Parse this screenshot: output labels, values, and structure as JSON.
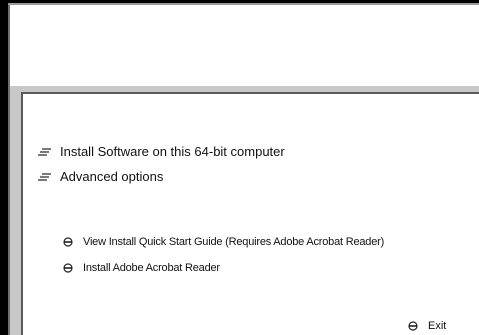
{
  "menu": {
    "main_items": [
      {
        "label": "Install Software on this 64-bit computer",
        "icon": "lines-icon"
      },
      {
        "label": "Advanced options",
        "icon": "lines-icon"
      }
    ],
    "sub_items": [
      {
        "label": "View Install Quick Start Guide (Requires Adobe Acrobat Reader)",
        "icon": "bullet-icon"
      },
      {
        "label": "Install Adobe Acrobat Reader",
        "icon": "bullet-icon"
      }
    ],
    "exit": {
      "label": "Exit",
      "icon": "bullet-icon"
    }
  },
  "colors": {
    "frame": "#000000",
    "strip": "#c8c8c8",
    "panel": "#ffffff",
    "text": "#111111"
  }
}
